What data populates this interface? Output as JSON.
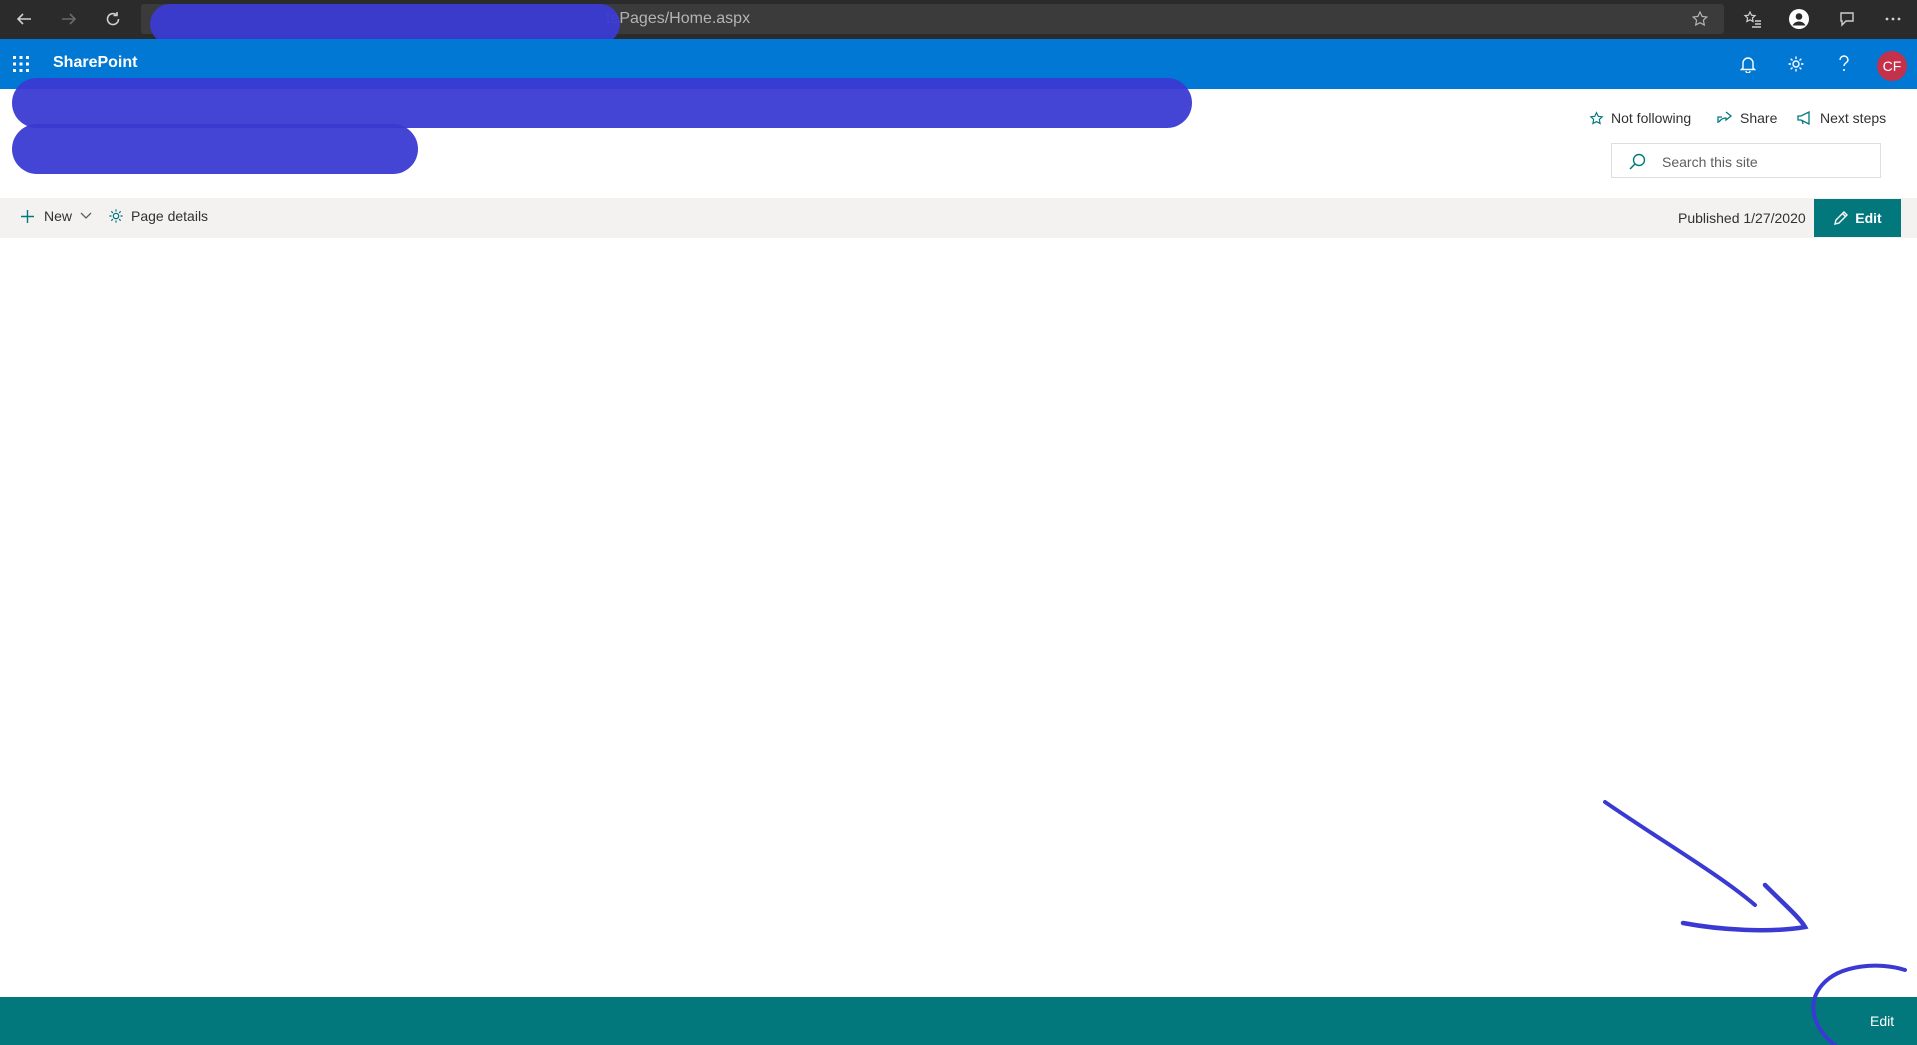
{
  "browser": {
    "address_text": "tePages/Home.aspx"
  },
  "suite_bar": {
    "title": "SharePoint",
    "avatar_initials": "CF",
    "accent_color": "#0078d4"
  },
  "site_header": {
    "follow_label": "Not following",
    "share_label": "Share",
    "next_steps_label": "Next steps",
    "search_placeholder": "Search this site"
  },
  "command_bar": {
    "new_label": "New",
    "page_details_label": "Page details",
    "published_status": "Published 1/27/2020",
    "edit_label": "Edit"
  },
  "bottom_bar": {
    "edit_label": "Edit",
    "color": "#03787c"
  },
  "annotation": {
    "color": "#3a3ad3",
    "shapes": [
      "arrow",
      "circle"
    ]
  }
}
